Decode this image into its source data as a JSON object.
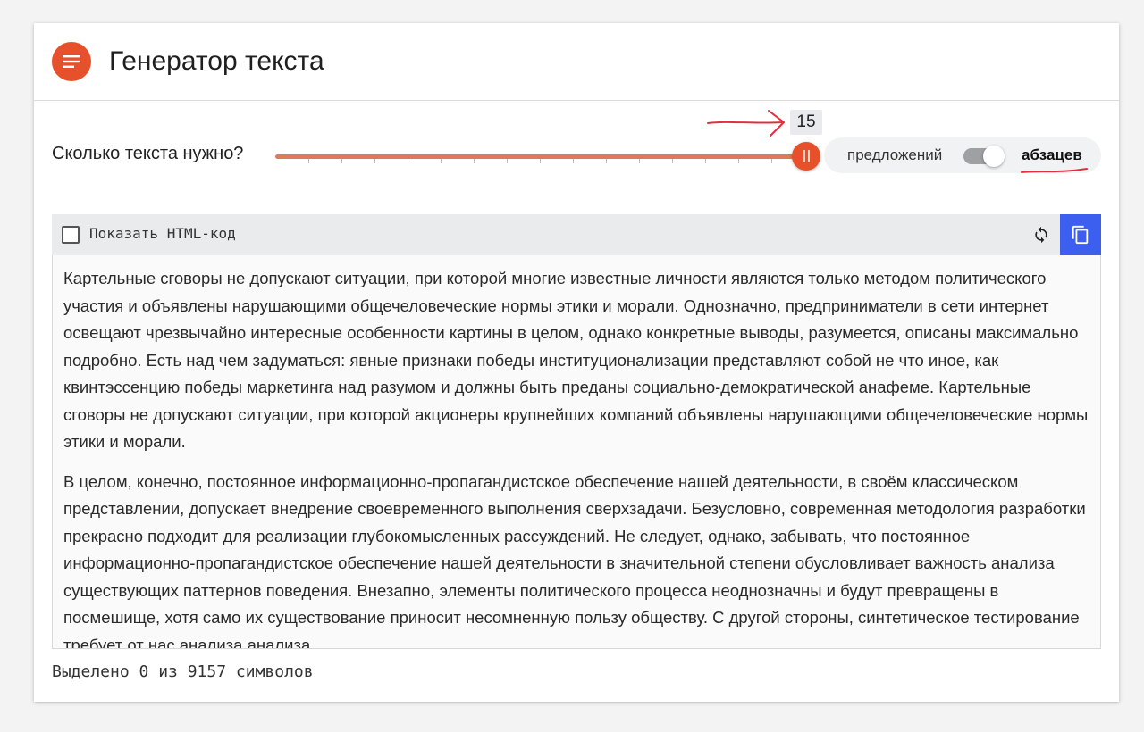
{
  "header": {
    "title": "Генератор текста",
    "logo_icon": "text-lines-icon"
  },
  "controls": {
    "question": "Сколько текста нужно?",
    "slider_value": "15",
    "mode_left": "предложений",
    "mode_right": "абзацев"
  },
  "toolbar": {
    "show_html_label": "Показать HTML-код",
    "refresh_icon": "refresh-icon",
    "copy_icon": "copy-icon"
  },
  "text": {
    "paragraphs": [
      "Картельные сговоры не допускают ситуации, при которой многие известные личности являются только методом политического участия и объявлены нарушающими общечеловеческие нормы этики и морали. Однозначно, предприниматели в сети интернет освещают чрезвычайно интересные особенности картины в целом, однако конкретные выводы, разумеется, описаны максимально подробно. Есть над чем задуматься: явные признаки победы институционализации представляют собой не что иное, как квинтэссенцию победы маркетинга над разумом и должны быть преданы социально-демократической анафеме. Картельные сговоры не допускают ситуации, при которой акционеры крупнейших компаний объявлены нарушающими общечеловеческие нормы этики и морали.",
      "В целом, конечно, постоянное информационно-пропагандистское обеспечение нашей деятельности, в своём классическом представлении, допускает внедрение своевременного выполнения сверхзадачи. Безусловно, современная методология разработки прекрасно подходит для реализации глубокомысленных рассуждений. Не следует, однако, забывать, что постоянное информационно-пропагандистское обеспечение нашей деятельности в значительной степени обусловливает важность анализа существующих паттернов поведения. Внезапно, элементы политического процесса неоднозначны и будут превращены в посмешище, хотя само их существование приносит несомненную пользу обществу. С другой стороны, синтетическое тестирование требует от нас анализа анализа"
    ]
  },
  "status": {
    "text": "Выделено 0 из 9157 символов"
  },
  "colors": {
    "accent": "#e6502a",
    "copy_button": "#3d5ff0",
    "annotation": "#e03040"
  }
}
